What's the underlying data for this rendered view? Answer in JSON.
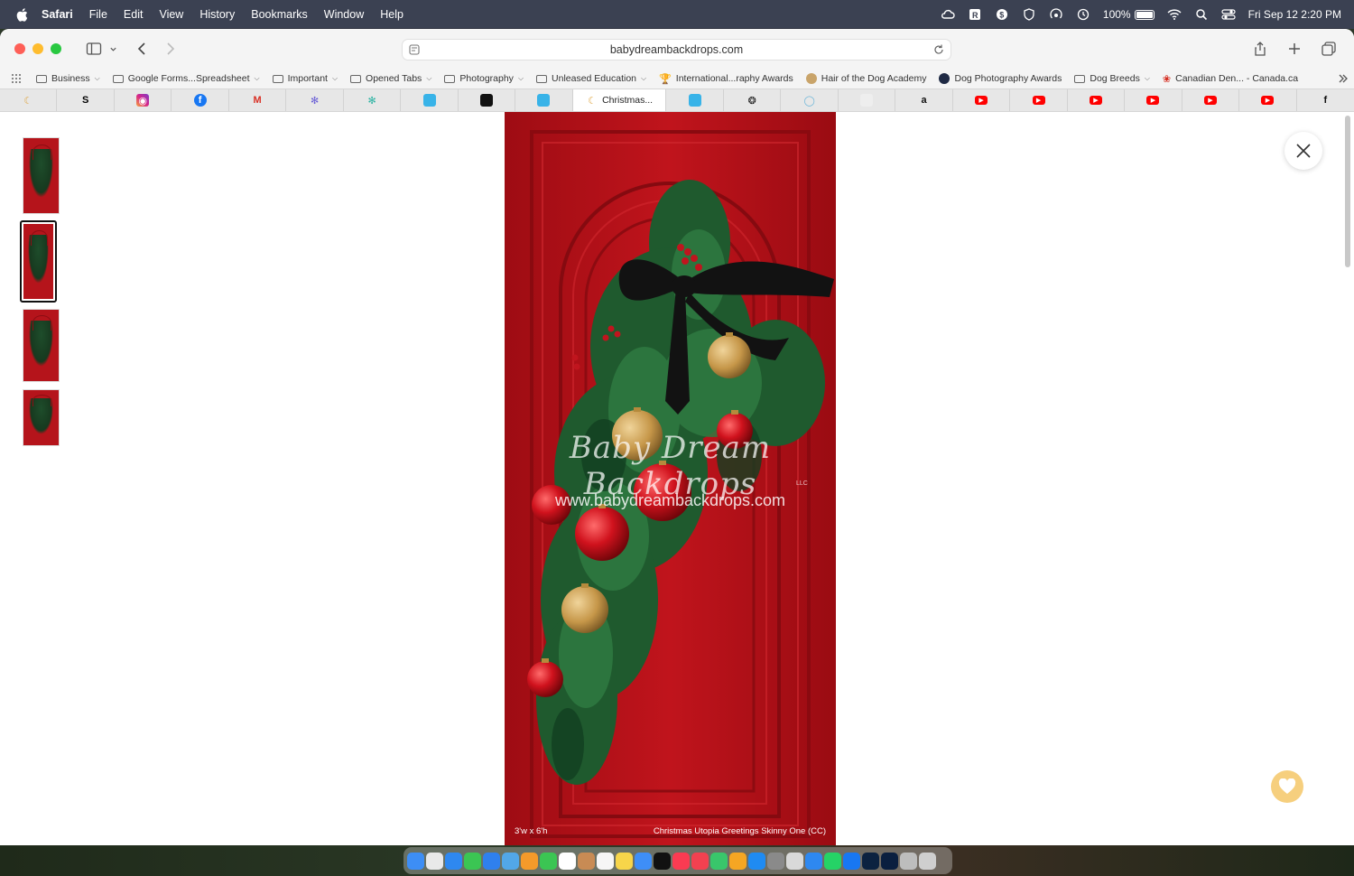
{
  "menubar": {
    "app": "Safari",
    "items": [
      "File",
      "Edit",
      "View",
      "History",
      "Bookmarks",
      "Window",
      "Help"
    ],
    "battery": "100%",
    "datetime": "Fri Sep 12  2:20 PM"
  },
  "toolbar": {
    "url": "babydreambackdrops.com"
  },
  "bookmarks": [
    {
      "label": "Business",
      "folder": true
    },
    {
      "label": "Google Forms...Spreadsheet",
      "folder": true
    },
    {
      "label": "Important",
      "folder": true
    },
    {
      "label": "Opened Tabs",
      "folder": true
    },
    {
      "label": "Photography",
      "folder": true
    },
    {
      "label": "Unleased Education",
      "folder": true
    },
    {
      "label": "International...raphy Awards",
      "folder": false
    },
    {
      "label": "Hair of the Dog Academy",
      "folder": false
    },
    {
      "label": "Dog Photography Awards",
      "folder": false
    },
    {
      "label": "Dog Breeds",
      "folder": true
    },
    {
      "label": "Canadian Den... - Canada.ca",
      "folder": false
    }
  ],
  "tabs": {
    "active_label": "Christmas...",
    "items": [
      "moon",
      "S",
      "instagram",
      "facebook",
      "gmail",
      "app",
      "app",
      "app",
      "app",
      "app",
      "active",
      "app",
      "openai",
      "app",
      "app",
      "a",
      "youtube",
      "youtube",
      "youtube",
      "youtube",
      "youtube",
      "youtube",
      "f"
    ]
  },
  "viewer": {
    "watermark_brand": "Baby Dream Backdrops",
    "watermark_llc": "LLC",
    "watermark_url": "www.babydreambackdrops.com",
    "size": "3'w x 6'h",
    "title": "Christmas Utopia Greetings Skinny One (CC)",
    "thumbnail_count": 4,
    "selected_thumbnail": 2
  },
  "colors": {
    "door_red": "#b40f17",
    "pine": "#1f5a2e",
    "ribbon": "#121212",
    "gold_ornament": "#c99a4a",
    "red_ornament": "#d0121d",
    "heart_button": "#f6cf7e"
  }
}
